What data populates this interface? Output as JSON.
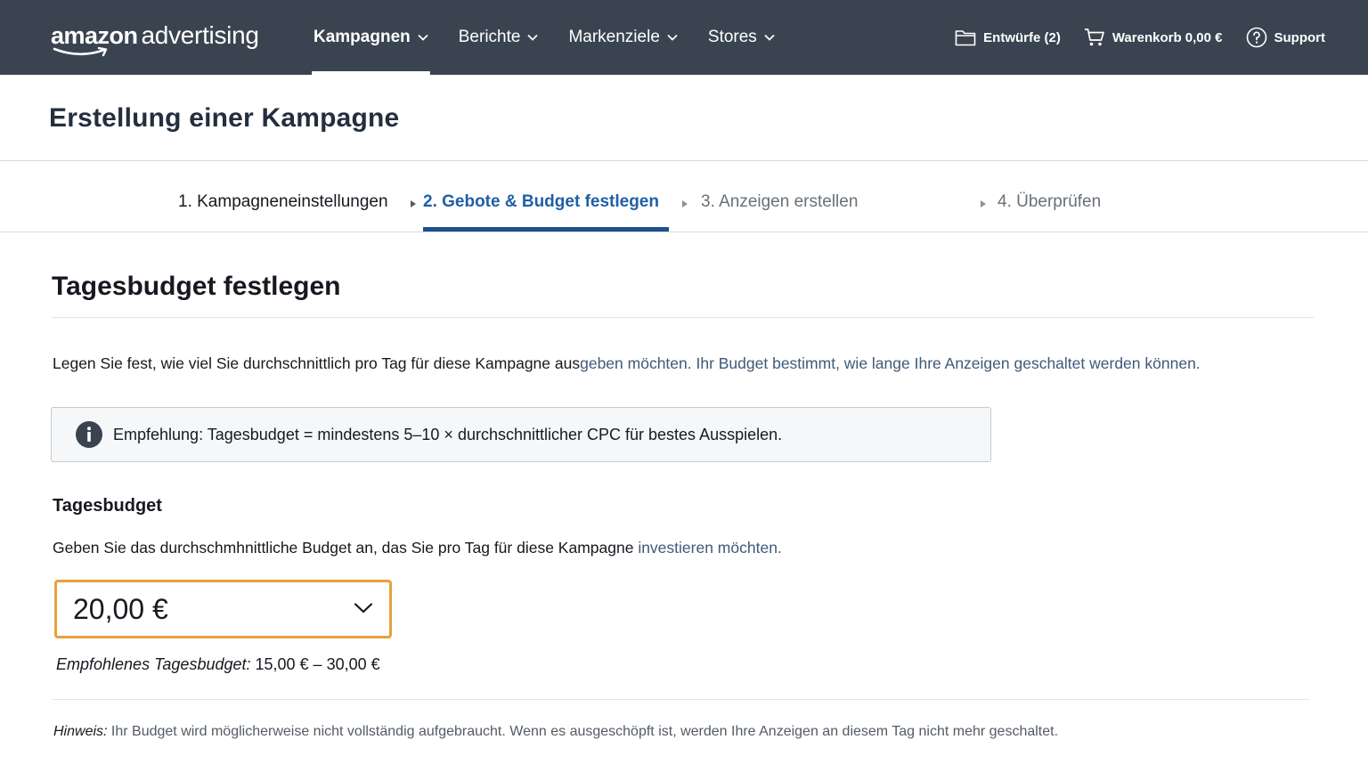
{
  "brand": {
    "logo_primary": "amazon",
    "logo_secondary": "advertising"
  },
  "nav": {
    "items": [
      {
        "label": "Kampagnen",
        "active": true
      },
      {
        "label": "Berichte",
        "active": false
      },
      {
        "label": "Markenziele",
        "active": false
      },
      {
        "label": "Stores",
        "active": false
      }
    ]
  },
  "tools": {
    "drafts": "Entwürfe (2)",
    "cart": "Warenkorb 0,00 €",
    "support": "Support"
  },
  "page": {
    "title": "Erstellung einer Kampagne"
  },
  "steps": [
    {
      "label": "1. Kampagneneinstellungen",
      "state": "done"
    },
    {
      "label": "2. Gebote & Budget festlegen",
      "state": "current"
    },
    {
      "label": "3. Anzeigen erstellen",
      "state": "upcoming"
    },
    {
      "label": "4. Überprüfen",
      "state": "upcoming"
    }
  ],
  "section": {
    "title": "Tagesbudget festlegen",
    "lead_a": "Legen Sie fest, wie viel Sie durchschnittlich pro Tag für diese Kampagne aus",
    "lead_b": "geben möchten. Ihr Budget bestimmt, wie lange Ihre Anzeigen geschaltet werden können."
  },
  "alert": {
    "icon": "info-icon",
    "text": "Empfehlung: Tagesbudget = mindestens 5–10 × durchschnittlicher CPC für bestes Ausspielen."
  },
  "budget": {
    "label": "Tagesbudget",
    "desc_a": "Geben Sie das durchschmhnittliche Budget an, das Sie pro Tag für diese Kampagne ",
    "desc_b": "investieren möchten.",
    "selected": "20,00 €",
    "recommended_label": "Empfohlenes Tagesbudget:",
    "recommended_value": " 15,00 € – 30,00 €"
  },
  "note": {
    "label": "Hinweis:",
    "text": " Ihr Budget wird möglicherweise nicht vollständig aufgebraucht. Wenn es ausgeschöpft ist, werden Ihre Anzeigen an diesem Tag nicht mehr geschaltet."
  },
  "colors": {
    "topbar": "#3a4451",
    "accent_blue": "#1f5fa8",
    "focus_orange": "#e8a13a"
  }
}
